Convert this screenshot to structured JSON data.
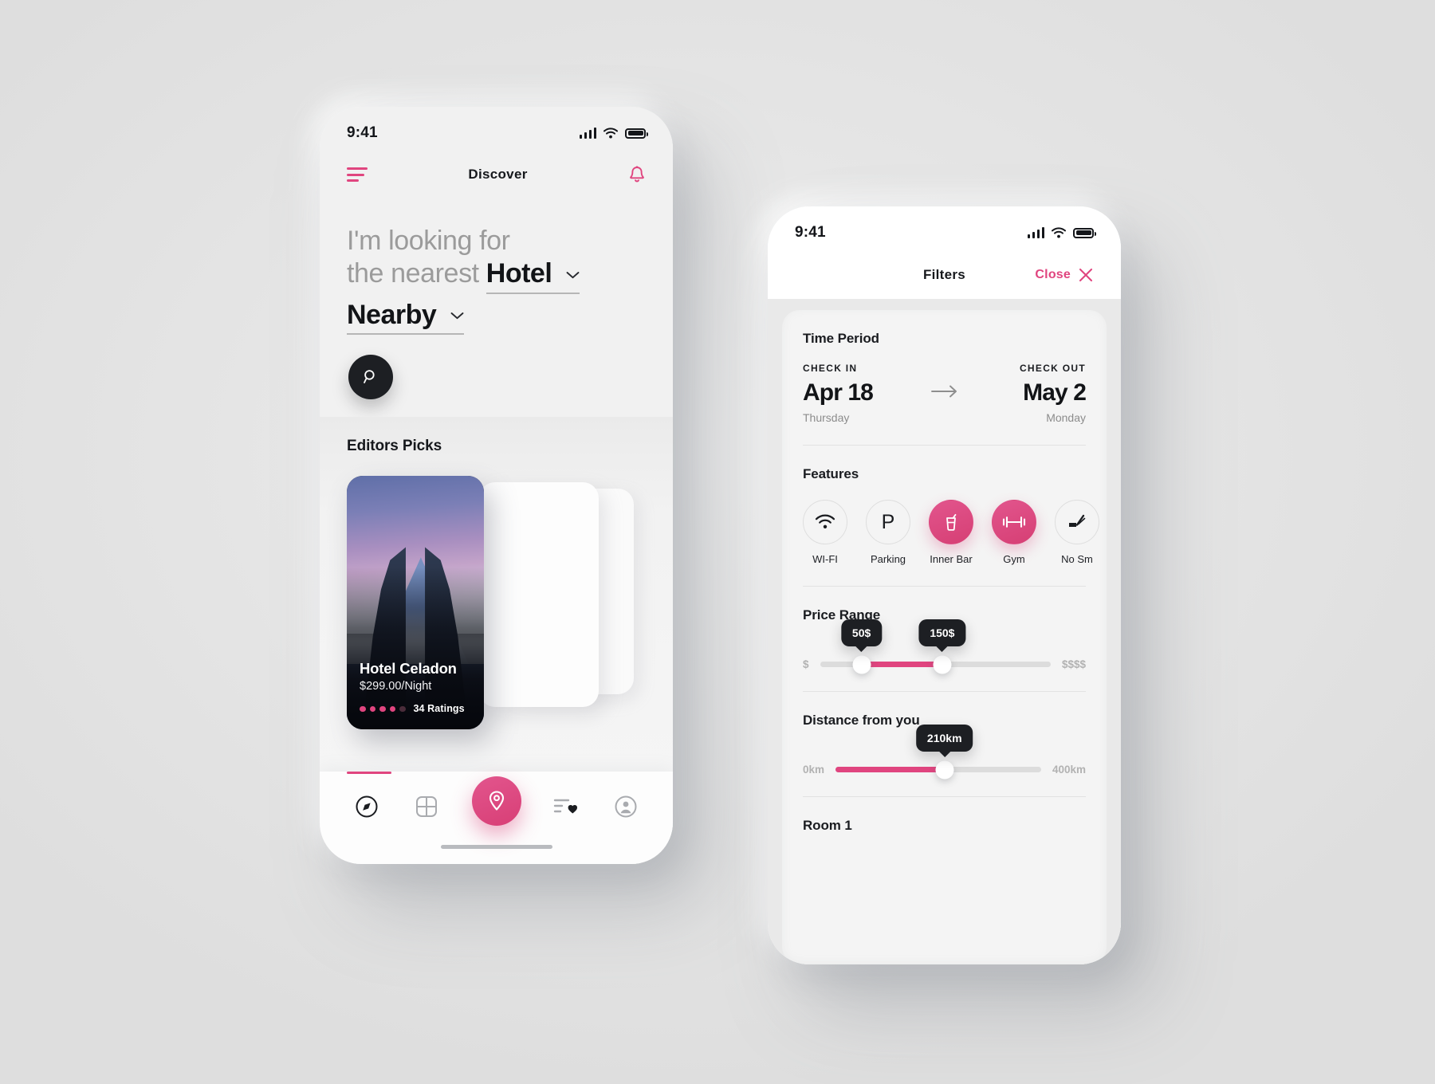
{
  "left_phone": {
    "status": {
      "time": "9:41",
      "signal_icon": "cellular-bars-icon",
      "wifi_icon": "wifi-icon",
      "battery_icon": "battery-icon"
    },
    "header": {
      "menu_icon": "hamburger-menu-icon",
      "title": "Discover",
      "bell_icon": "bell-icon"
    },
    "hero": {
      "line1": "I'm looking for",
      "line2_prefix": "the nearest",
      "category": "Hotel",
      "location": "Nearby",
      "search_icon": "search-icon"
    },
    "section_title": "Editors Picks",
    "card": {
      "name": "Hotel Celadon",
      "price": "$299.00/Night",
      "ratings": "34 Ratings",
      "rating_filled": 4,
      "rating_total": 5
    },
    "tabs": [
      {
        "name": "tab-explore",
        "icon": "compass-icon",
        "active": false
      },
      {
        "name": "tab-categories",
        "icon": "grid-icon",
        "active": false
      },
      {
        "name": "tab-map",
        "icon": "location-pin-icon",
        "active": true
      },
      {
        "name": "tab-wishlist",
        "icon": "list-heart-icon",
        "active": false
      },
      {
        "name": "tab-profile",
        "icon": "user-circle-icon",
        "active": false
      }
    ]
  },
  "right_phone": {
    "status": {
      "time": "9:41",
      "signal_icon": "cellular-bars-icon",
      "wifi_icon": "wifi-icon",
      "battery_icon": "battery-icon"
    },
    "header": {
      "title": "Filters",
      "close_label": "Close",
      "close_icon": "close-x-icon"
    },
    "time_period": {
      "title": "Time Period",
      "check_in_label": "CHECK IN",
      "check_in_date": "Apr 18",
      "check_in_day": "Thursday",
      "arrow_icon": "arrow-right-icon",
      "check_out_label": "CHECK OUT",
      "check_out_date": "May 2",
      "check_out_day": "Monday"
    },
    "features": {
      "title": "Features",
      "items": [
        {
          "label": "WI-FI",
          "icon": "wifi-icon",
          "active": false
        },
        {
          "label": "Parking",
          "icon": "parking-p-icon",
          "active": false
        },
        {
          "label": "Inner Bar",
          "icon": "drink-glass-icon",
          "active": true
        },
        {
          "label": "Gym",
          "icon": "dumbbell-icon",
          "active": true
        },
        {
          "label": "No Sm",
          "icon": "no-smoking-icon",
          "active": false
        }
      ]
    },
    "price_range": {
      "title": "Price Range",
      "min_label": "$",
      "max_label": "$$$$",
      "low_value": "50$",
      "high_value": "150$",
      "low_pct": 18,
      "high_pct": 53
    },
    "distance": {
      "title": "Distance from you",
      "min_label": "0km",
      "max_label": "400km",
      "value": "210km",
      "value_pct": 53
    },
    "room": {
      "title": "Room 1"
    }
  },
  "colors": {
    "accent": "#e0457f",
    "dark": "#1d1f23",
    "muted": "#9b9b9b",
    "bg": "#e9e9e9"
  }
}
